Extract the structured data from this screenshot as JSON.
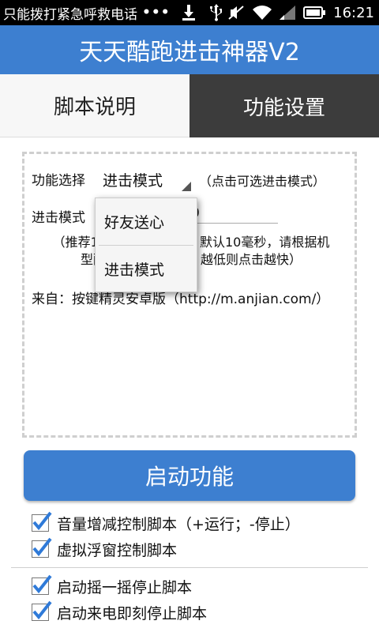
{
  "status_bar": {
    "notice": "只能拨打紧急呼救电话",
    "dots": "•••",
    "time": "16:21",
    "icons": [
      "download-icon",
      "usb-icon",
      "mute-icon",
      "wifi-icon",
      "signal-icon",
      "battery-icon"
    ]
  },
  "app": {
    "title": "天天酷跑进击神器V2"
  },
  "tabs": [
    {
      "label": "脚本说明"
    },
    {
      "label": "功能设置"
    }
  ],
  "settings": {
    "function_label": "功能选择",
    "function_value": "进击模式",
    "function_hint": "（点击可选进击模式）",
    "mode_label": "进击模式",
    "mode_field_tail": "0",
    "note_line1": "（推荐10",
    "note_line1_tail": "默认10毫秒，请根据机",
    "note_line2": "型配",
    "note_line2_tail": "越低则点击越快）",
    "source": "来自：按键精灵安卓版（http://m.anjian.com/）"
  },
  "dropdown": {
    "options": [
      "好友送心",
      "进击模式"
    ]
  },
  "start_button": {
    "label": "启动功能"
  },
  "checkboxes": [
    {
      "label": "音量增减控制脚本（+运行；-停止）",
      "checked": true
    },
    {
      "label": "虚拟浮窗控制脚本",
      "checked": true
    },
    {
      "label": "启动摇一摇停止脚本",
      "checked": true
    },
    {
      "label": "启动来电即刻停止脚本",
      "checked": true
    }
  ],
  "colors": {
    "accent": "#3d7fd0",
    "tab_active": "#3c3c3c",
    "check": "#2f7ad8"
  }
}
